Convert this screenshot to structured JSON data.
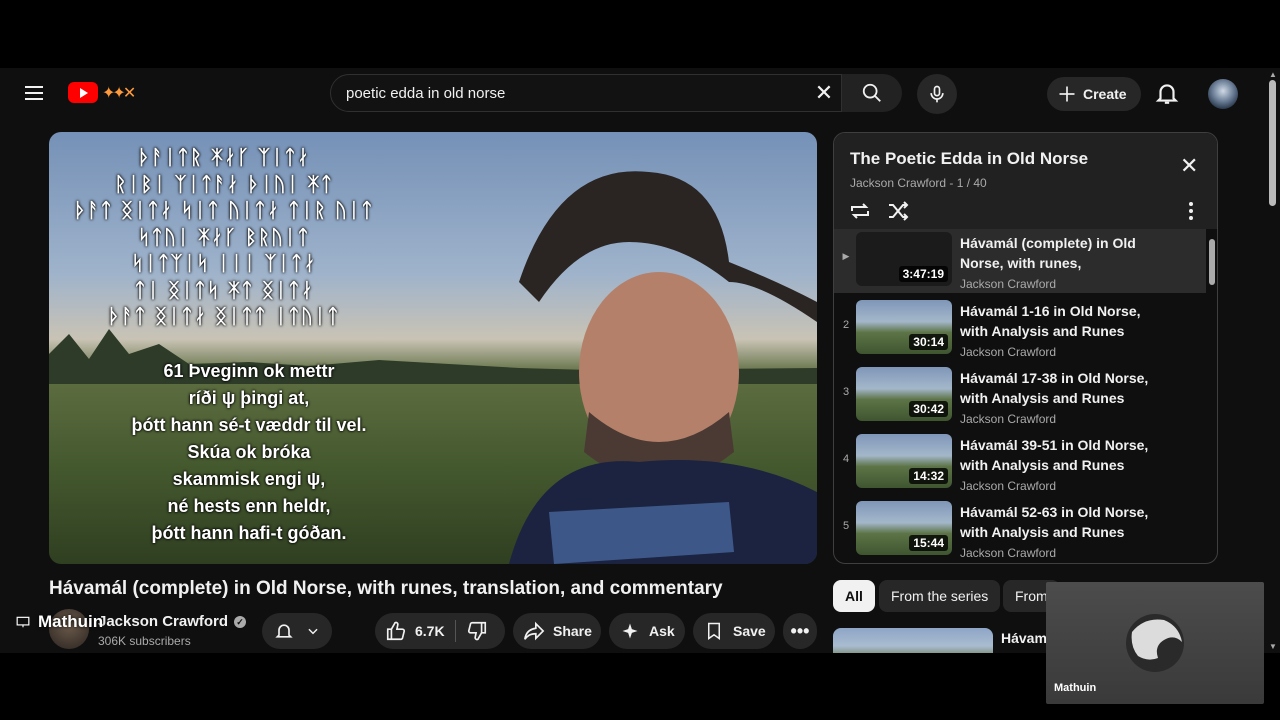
{
  "header": {
    "search_value": "poetic edda in old norse",
    "create_label": "Create"
  },
  "video": {
    "title": "Hávamál (complete) in Old Norse, with runes, translation, and commentary",
    "rune_lines": [
      "ᚦᚨᛁᛏᚱ ᛡᛅᚴ ᛉᛁᛏᛅ",
      "ᚱᛁᛒᛁ ᛉᛁᛏᚨᛅ ᚦᛁᚢᛁ ᛡᛏ",
      "ᚦᚨᛏ ᛝᛁᛏᛅ ᛋᛁᛏ ᚢᛁᛏᛅ ᛏᛁᚱ ᚢᛁᛏ",
      "ᛋᛏᚢᛁ ᛡᛅᚴ ᛒᚱᚢᛁᛏ",
      "ᛋᛁᛏᛉᛁᛋ ᛁᛁᛁ ᛉᛁᛏᛅ",
      "ᛏᛁ ᛝᛁᛏᛋ ᛡᛏ ᛝᛁᛏᛅ",
      "ᚦᚨᛏ ᛝᛁᛏᛅ ᛝᛁᛏᛏ ᛁᛏᚢᛁᛏ"
    ],
    "verse_lines": [
      "61 Þveginn ok mettr",
      "ríði ψ þingi at,",
      "þótt hann sé-t væddr til vel.",
      "Skúa ok bróka",
      "skammisk engi ψ,",
      "né hests enn heldr,",
      "þótt hann hafi-t góðan."
    ]
  },
  "channel": {
    "name": "Jackson Crawford",
    "subscribers": "306K subscribers"
  },
  "overlay_user": "Mathuin",
  "actions": {
    "likes": "6.7K",
    "share": "Share",
    "ask": "Ask",
    "save": "Save"
  },
  "playlist": {
    "title": "The Poetic Edda in Old Norse",
    "subtitle": "Jackson Crawford - 1 / 40",
    "items": [
      {
        "index": "",
        "title": "Hávamál (complete) in Old Norse, with runes, translation,...",
        "channel": "Jackson Crawford",
        "duration": "3:47:19"
      },
      {
        "index": "2",
        "title": "Hávamál 1-16 in Old Norse, with Analysis and Runes",
        "channel": "Jackson Crawford",
        "duration": "30:14"
      },
      {
        "index": "3",
        "title": "Hávamál 17-38 in Old Norse, with Analysis and Runes",
        "channel": "Jackson Crawford",
        "duration": "30:42"
      },
      {
        "index": "4",
        "title": "Hávamál 39-51 in Old Norse, with Analysis and Runes",
        "channel": "Jackson Crawford",
        "duration": "14:32"
      },
      {
        "index": "5",
        "title": "Hávamál 52-63 in Old Norse, with Analysis and Runes",
        "channel": "Jackson Crawford",
        "duration": "15:44"
      }
    ]
  },
  "chips": [
    "All",
    "From the series",
    "From"
  ],
  "rec": {
    "title": "Hávama"
  },
  "webcam": {
    "label": "Mathuin"
  },
  "colors": {
    "background": "#0f0f0f",
    "accent": "#ff0000",
    "panel": "#212121"
  }
}
